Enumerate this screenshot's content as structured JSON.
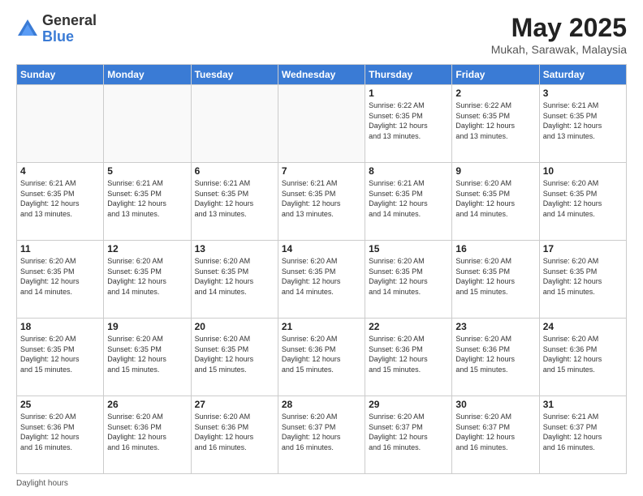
{
  "header": {
    "logo": {
      "general": "General",
      "blue": "Blue"
    },
    "month": "May 2025",
    "location": "Mukah, Sarawak, Malaysia"
  },
  "days_of_week": [
    "Sunday",
    "Monday",
    "Tuesday",
    "Wednesday",
    "Thursday",
    "Friday",
    "Saturday"
  ],
  "weeks": [
    [
      {
        "day": "",
        "info": ""
      },
      {
        "day": "",
        "info": ""
      },
      {
        "day": "",
        "info": ""
      },
      {
        "day": "",
        "info": ""
      },
      {
        "day": "1",
        "info": "Sunrise: 6:22 AM\nSunset: 6:35 PM\nDaylight: 12 hours\nand 13 minutes."
      },
      {
        "day": "2",
        "info": "Sunrise: 6:22 AM\nSunset: 6:35 PM\nDaylight: 12 hours\nand 13 minutes."
      },
      {
        "day": "3",
        "info": "Sunrise: 6:21 AM\nSunset: 6:35 PM\nDaylight: 12 hours\nand 13 minutes."
      }
    ],
    [
      {
        "day": "4",
        "info": "Sunrise: 6:21 AM\nSunset: 6:35 PM\nDaylight: 12 hours\nand 13 minutes."
      },
      {
        "day": "5",
        "info": "Sunrise: 6:21 AM\nSunset: 6:35 PM\nDaylight: 12 hours\nand 13 minutes."
      },
      {
        "day": "6",
        "info": "Sunrise: 6:21 AM\nSunset: 6:35 PM\nDaylight: 12 hours\nand 13 minutes."
      },
      {
        "day": "7",
        "info": "Sunrise: 6:21 AM\nSunset: 6:35 PM\nDaylight: 12 hours\nand 13 minutes."
      },
      {
        "day": "8",
        "info": "Sunrise: 6:21 AM\nSunset: 6:35 PM\nDaylight: 12 hours\nand 14 minutes."
      },
      {
        "day": "9",
        "info": "Sunrise: 6:20 AM\nSunset: 6:35 PM\nDaylight: 12 hours\nand 14 minutes."
      },
      {
        "day": "10",
        "info": "Sunrise: 6:20 AM\nSunset: 6:35 PM\nDaylight: 12 hours\nand 14 minutes."
      }
    ],
    [
      {
        "day": "11",
        "info": "Sunrise: 6:20 AM\nSunset: 6:35 PM\nDaylight: 12 hours\nand 14 minutes."
      },
      {
        "day": "12",
        "info": "Sunrise: 6:20 AM\nSunset: 6:35 PM\nDaylight: 12 hours\nand 14 minutes."
      },
      {
        "day": "13",
        "info": "Sunrise: 6:20 AM\nSunset: 6:35 PM\nDaylight: 12 hours\nand 14 minutes."
      },
      {
        "day": "14",
        "info": "Sunrise: 6:20 AM\nSunset: 6:35 PM\nDaylight: 12 hours\nand 14 minutes."
      },
      {
        "day": "15",
        "info": "Sunrise: 6:20 AM\nSunset: 6:35 PM\nDaylight: 12 hours\nand 14 minutes."
      },
      {
        "day": "16",
        "info": "Sunrise: 6:20 AM\nSunset: 6:35 PM\nDaylight: 12 hours\nand 15 minutes."
      },
      {
        "day": "17",
        "info": "Sunrise: 6:20 AM\nSunset: 6:35 PM\nDaylight: 12 hours\nand 15 minutes."
      }
    ],
    [
      {
        "day": "18",
        "info": "Sunrise: 6:20 AM\nSunset: 6:35 PM\nDaylight: 12 hours\nand 15 minutes."
      },
      {
        "day": "19",
        "info": "Sunrise: 6:20 AM\nSunset: 6:35 PM\nDaylight: 12 hours\nand 15 minutes."
      },
      {
        "day": "20",
        "info": "Sunrise: 6:20 AM\nSunset: 6:35 PM\nDaylight: 12 hours\nand 15 minutes."
      },
      {
        "day": "21",
        "info": "Sunrise: 6:20 AM\nSunset: 6:36 PM\nDaylight: 12 hours\nand 15 minutes."
      },
      {
        "day": "22",
        "info": "Sunrise: 6:20 AM\nSunset: 6:36 PM\nDaylight: 12 hours\nand 15 minutes."
      },
      {
        "day": "23",
        "info": "Sunrise: 6:20 AM\nSunset: 6:36 PM\nDaylight: 12 hours\nand 15 minutes."
      },
      {
        "day": "24",
        "info": "Sunrise: 6:20 AM\nSunset: 6:36 PM\nDaylight: 12 hours\nand 15 minutes."
      }
    ],
    [
      {
        "day": "25",
        "info": "Sunrise: 6:20 AM\nSunset: 6:36 PM\nDaylight: 12 hours\nand 16 minutes."
      },
      {
        "day": "26",
        "info": "Sunrise: 6:20 AM\nSunset: 6:36 PM\nDaylight: 12 hours\nand 16 minutes."
      },
      {
        "day": "27",
        "info": "Sunrise: 6:20 AM\nSunset: 6:36 PM\nDaylight: 12 hours\nand 16 minutes."
      },
      {
        "day": "28",
        "info": "Sunrise: 6:20 AM\nSunset: 6:37 PM\nDaylight: 12 hours\nand 16 minutes."
      },
      {
        "day": "29",
        "info": "Sunrise: 6:20 AM\nSunset: 6:37 PM\nDaylight: 12 hours\nand 16 minutes."
      },
      {
        "day": "30",
        "info": "Sunrise: 6:20 AM\nSunset: 6:37 PM\nDaylight: 12 hours\nand 16 minutes."
      },
      {
        "day": "31",
        "info": "Sunrise: 6:21 AM\nSunset: 6:37 PM\nDaylight: 12 hours\nand 16 minutes."
      }
    ]
  ],
  "footer": {
    "daylight_label": "Daylight hours"
  }
}
